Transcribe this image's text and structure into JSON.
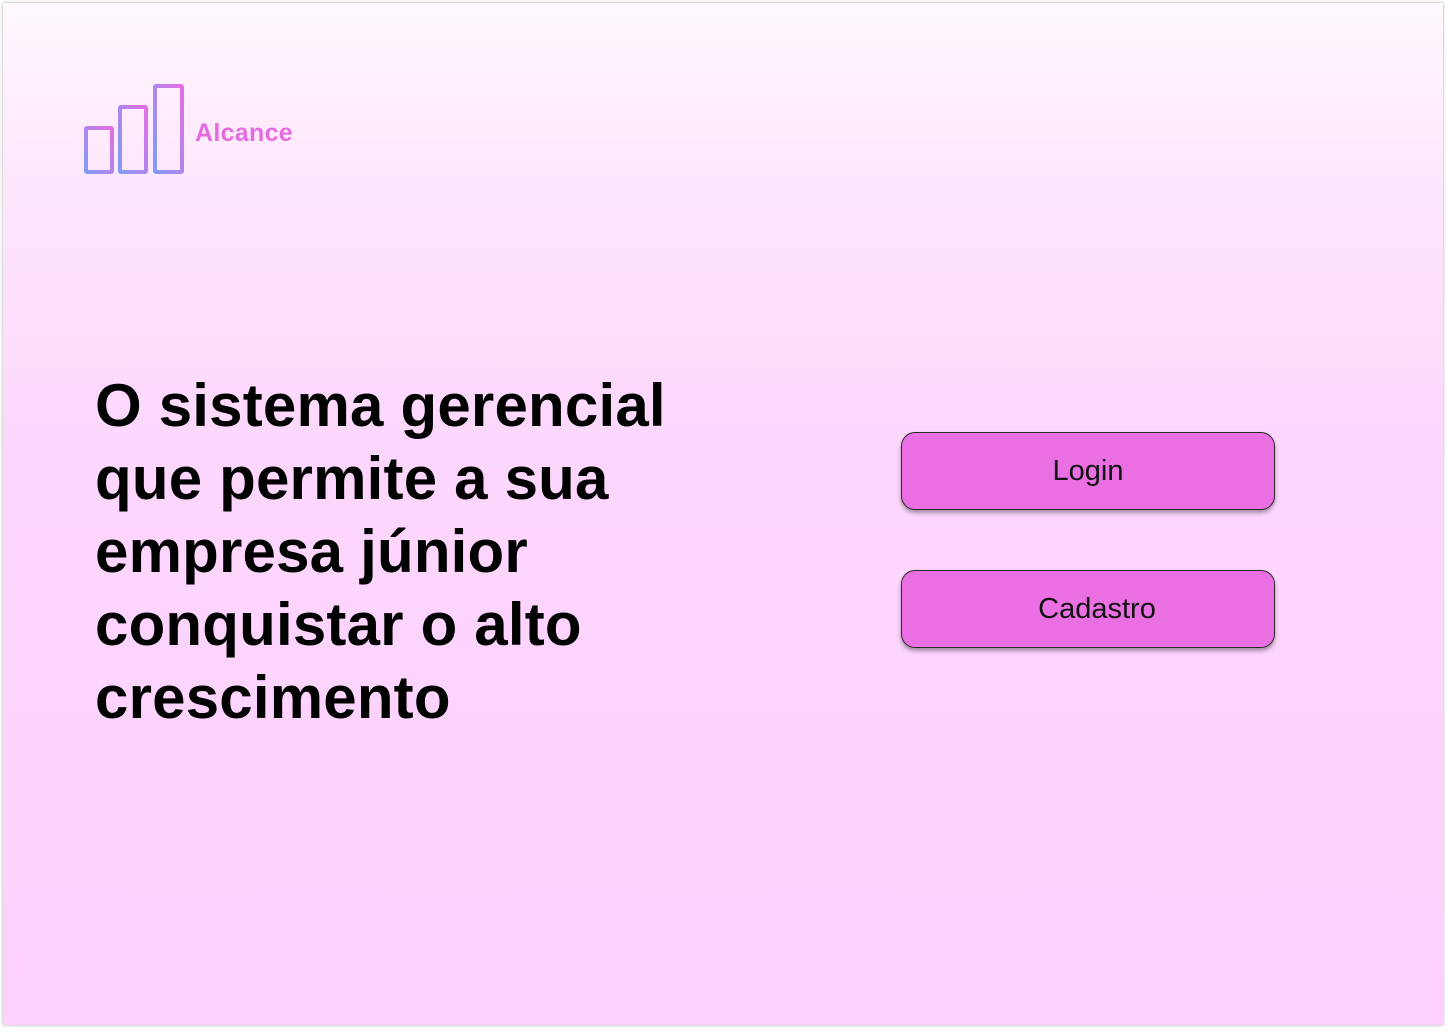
{
  "brand": {
    "name": "Alcance",
    "icon": "bar-chart-logo-icon",
    "colors": {
      "pink": "#e66be0",
      "blue": "#7f9cf5"
    }
  },
  "hero": {
    "headline": "O sistema  gerencial que permite a sua empresa júnior conquistar o alto crescimento"
  },
  "actions": {
    "login_label": "Login",
    "signup_label": "Cadastro",
    "button_color": "#ea6fe3"
  }
}
